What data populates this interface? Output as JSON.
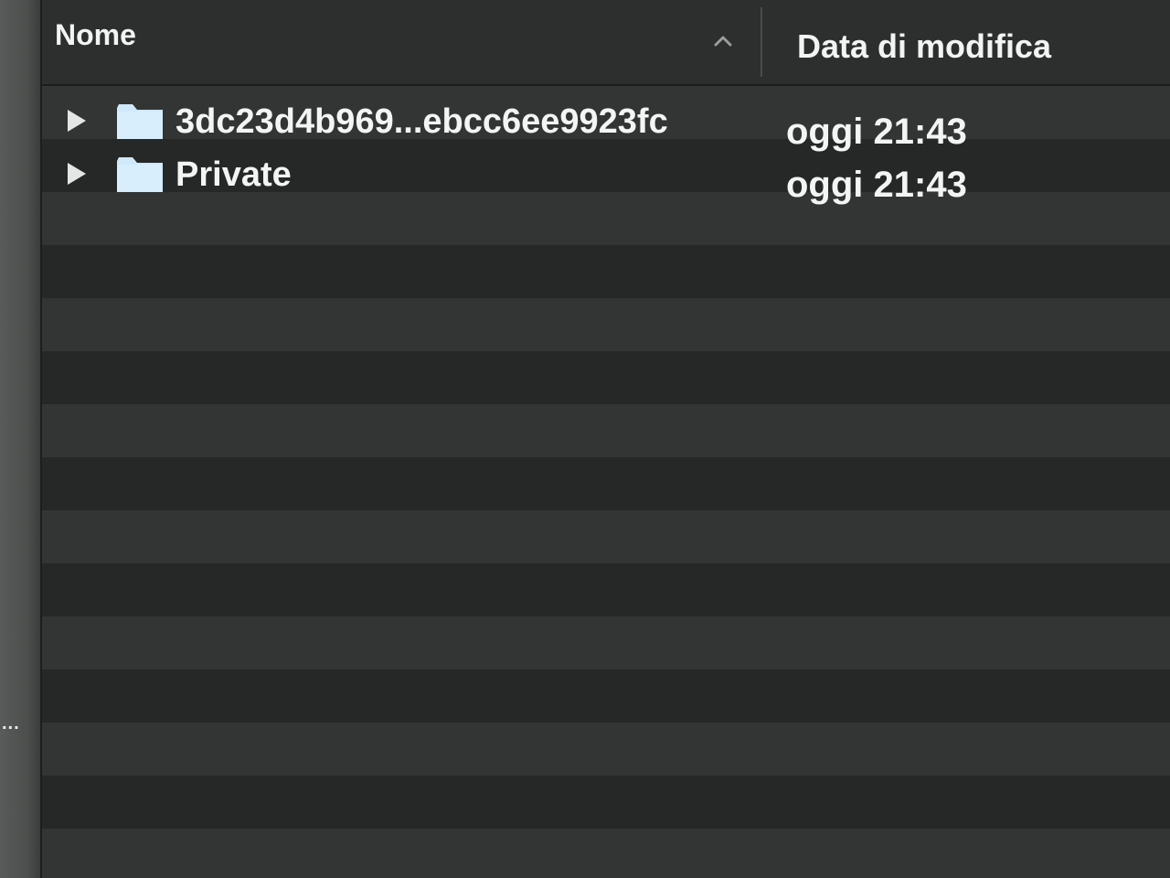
{
  "header": {
    "name_column": "Nome",
    "date_column": "Data di modifica",
    "sort_icon": "chevron-up-icon"
  },
  "sidebar": {
    "overflow_text": "..."
  },
  "files": [
    {
      "name": "3dc23d4b969...ebcc6ee9923fc",
      "date": "oggi 21:43",
      "icon": "folder-icon"
    },
    {
      "name": "Private",
      "date": "oggi 21:43",
      "icon": "folder-icon"
    }
  ],
  "colors": {
    "folder": "#cfe9fb",
    "text": "#f3f5f4",
    "row_light": "#323534",
    "row_dark": "#262827"
  }
}
